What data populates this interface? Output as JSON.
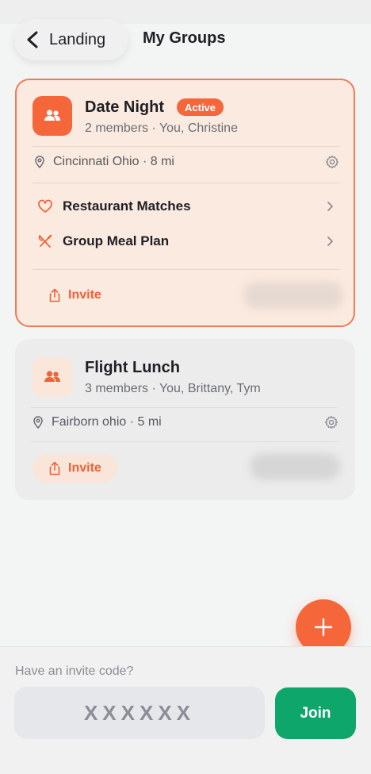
{
  "header": {
    "back_label": "Landing",
    "title": "My Groups"
  },
  "groups": [
    {
      "name": "Date Night",
      "badge": "Active",
      "members": "2 members · You, Christine",
      "location": "Cincinnati Ohio · 8 mi",
      "menu": [
        {
          "label": "Restaurant Matches",
          "icon": "heart-icon"
        },
        {
          "label": "Group Meal Plan",
          "icon": "utensils-icon"
        }
      ],
      "invite_label": "Invite"
    },
    {
      "name": "Flight Lunch",
      "members": "3 members · You, Brittany, Tym",
      "location": "Fairborn ohio · 5 mi",
      "invite_label": "Invite"
    }
  ],
  "fab": {
    "icon": "plus-icon"
  },
  "footer": {
    "prompt": "Have an invite code?",
    "code_placeholder": "XXXXXX",
    "join_label": "Join"
  },
  "colors": {
    "accent": "#f5663b",
    "active_card_bg": "#fbeadf",
    "join_green": "#0ea66b"
  }
}
